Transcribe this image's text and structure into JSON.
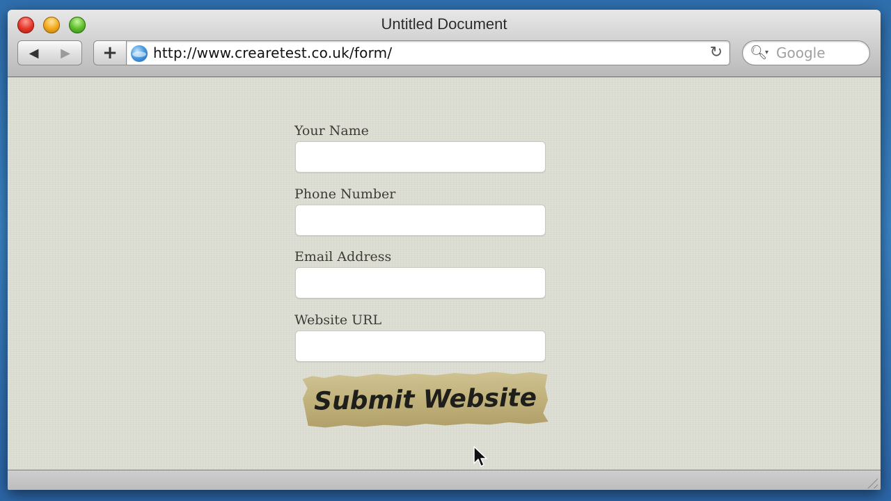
{
  "window": {
    "title": "Untitled Document"
  },
  "toolbar": {
    "back_icon": "◀",
    "forward_icon": "▶",
    "add_icon": "+",
    "reload_icon": "↻",
    "search_glyph": "🔍︎",
    "search_caret": "▾"
  },
  "address_bar": {
    "url": "http://www.crearetest.co.uk/form/"
  },
  "search": {
    "placeholder": "Google"
  },
  "form": {
    "fields": [
      {
        "label": "Your Name",
        "value": ""
      },
      {
        "label": "Phone Number",
        "value": ""
      },
      {
        "label": "Email Address",
        "value": ""
      },
      {
        "label": "Website URL",
        "value": ""
      }
    ],
    "submit_label": "Submit Website"
  },
  "colors": {
    "page_background": "#dcddd2",
    "submit_paper": "#c1b27c"
  }
}
